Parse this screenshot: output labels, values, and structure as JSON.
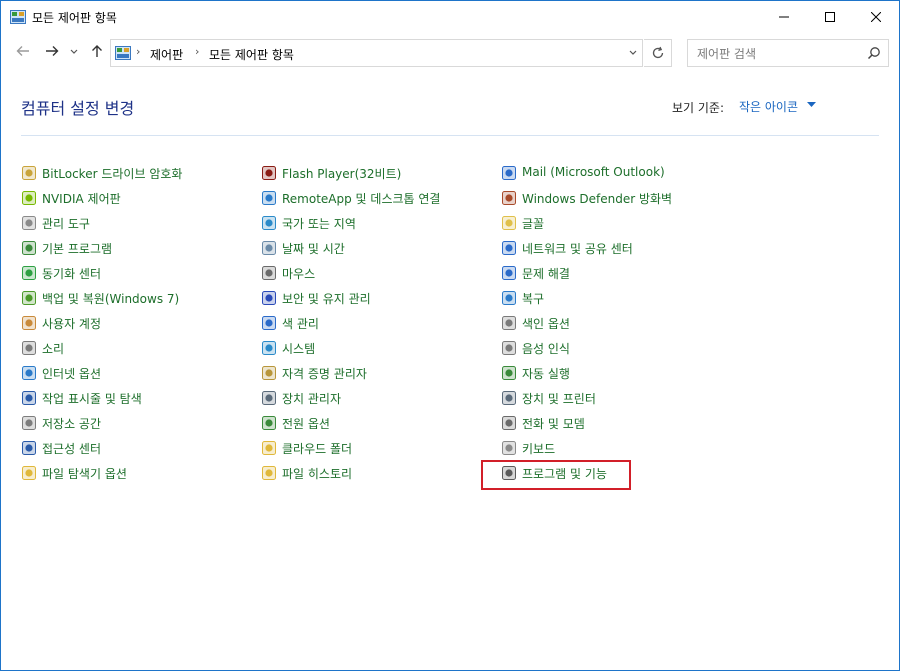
{
  "window": {
    "title": "모든 제어판 항목",
    "minimize": "—",
    "maximize": "☐",
    "close": "✕"
  },
  "nav": {
    "back": "←",
    "forward": "→",
    "recent": "⌄",
    "up": "↑",
    "breadcrumbs": [
      "제어판",
      "모든 제어판 항목"
    ],
    "separator": "›",
    "dropdown": "⌄",
    "refresh": "↻"
  },
  "search": {
    "placeholder": "제어판 검색"
  },
  "header": {
    "title": "컴퓨터 설정 변경",
    "view_by_label": "보기 기준:",
    "view_by_value": "작은 아이콘"
  },
  "columns": [
    [
      {
        "label": "BitLocker 드라이브 암호화",
        "icon": "bitlocker-icon",
        "color": "#c9a43a"
      },
      {
        "label": "NVIDIA 제어판",
        "icon": "nvidia-icon",
        "color": "#76b900"
      },
      {
        "label": "관리 도구",
        "icon": "admin-tools-icon",
        "color": "#8a8a8a"
      },
      {
        "label": "기본 프로그램",
        "icon": "default-programs-icon",
        "color": "#3a8a3a"
      },
      {
        "label": "동기화 센터",
        "icon": "sync-center-icon",
        "color": "#2ea043"
      },
      {
        "label": "백업 및 복원(Windows 7)",
        "icon": "backup-restore-icon",
        "color": "#4c9a2a"
      },
      {
        "label": "사용자 계정",
        "icon": "user-accounts-icon",
        "color": "#c98a3a"
      },
      {
        "label": "소리",
        "icon": "sound-icon",
        "color": "#7a7a7a"
      },
      {
        "label": "인터넷 옵션",
        "icon": "internet-options-icon",
        "color": "#2a7ac9"
      },
      {
        "label": "작업 표시줄 및 탐색",
        "icon": "taskbar-icon",
        "color": "#2a5aa8"
      },
      {
        "label": "저장소 공간",
        "icon": "storage-spaces-icon",
        "color": "#7d7d7d"
      },
      {
        "label": "접근성 센터",
        "icon": "ease-of-access-icon",
        "color": "#2a5aa8"
      },
      {
        "label": "파일 탐색기 옵션",
        "icon": "file-explorer-options-icon",
        "color": "#e0b83a"
      }
    ],
    [
      {
        "label": "Flash Player(32비트)",
        "icon": "flash-player-icon",
        "color": "#8a1c14"
      },
      {
        "label": "RemoteApp 및 데스크톱 연결",
        "icon": "remoteapp-icon",
        "color": "#2a7ac9"
      },
      {
        "label": "국가 또는 지역",
        "icon": "region-icon",
        "color": "#2a8ac9"
      },
      {
        "label": "날짜 및 시간",
        "icon": "date-time-icon",
        "color": "#6a8aa8"
      },
      {
        "label": "마우스",
        "icon": "mouse-icon",
        "color": "#6a6a6a"
      },
      {
        "label": "보안 및 유지 관리",
        "icon": "security-maintenance-icon",
        "color": "#2a4ab8"
      },
      {
        "label": "색 관리",
        "icon": "color-management-icon",
        "color": "#2a6ac9"
      },
      {
        "label": "시스템",
        "icon": "system-icon",
        "color": "#2a8ac9"
      },
      {
        "label": "자격 증명 관리자",
        "icon": "credential-manager-icon",
        "color": "#b8963a"
      },
      {
        "label": "장치 관리자",
        "icon": "device-manager-icon",
        "color": "#5a6a7a"
      },
      {
        "label": "전원 옵션",
        "icon": "power-options-icon",
        "color": "#3a8a3a"
      },
      {
        "label": "클라우드 폴더",
        "icon": "work-folders-icon",
        "color": "#e0b83a"
      },
      {
        "label": "파일 히스토리",
        "icon": "file-history-icon",
        "color": "#e0b83a"
      }
    ],
    [
      {
        "label": "Mail (Microsoft Outlook)",
        "icon": "mail-icon",
        "color": "#2a6ac9"
      },
      {
        "label": "Windows Defender 방화벽",
        "icon": "firewall-icon",
        "color": "#a84a2a"
      },
      {
        "label": "글꼴",
        "icon": "fonts-icon",
        "color": "#e0c04a"
      },
      {
        "label": "네트워크 및 공유 센터",
        "icon": "network-sharing-icon",
        "color": "#2a6ac9"
      },
      {
        "label": "문제 해결",
        "icon": "troubleshooting-icon",
        "color": "#2a6ac9"
      },
      {
        "label": "복구",
        "icon": "recovery-icon",
        "color": "#2a7ac9"
      },
      {
        "label": "색인 옵션",
        "icon": "indexing-options-icon",
        "color": "#7a7a7a"
      },
      {
        "label": "음성 인식",
        "icon": "speech-recognition-icon",
        "color": "#7a7a7a"
      },
      {
        "label": "자동 실행",
        "icon": "autoplay-icon",
        "color": "#3a8a3a"
      },
      {
        "label": "장치 및 프린터",
        "icon": "devices-printers-icon",
        "color": "#5a6a7a"
      },
      {
        "label": "전화 및 모뎀",
        "icon": "phone-modem-icon",
        "color": "#6a6a6a"
      },
      {
        "label": "키보드",
        "icon": "keyboard-icon",
        "color": "#8a8a8a"
      },
      {
        "label": "프로그램 및 기능",
        "icon": "programs-features-icon",
        "color": "#5a5a5a"
      }
    ]
  ],
  "highlighted_item": "프로그램 및 기능",
  "colors": {
    "link": "#1c6e2a",
    "heading": "#1e3287",
    "accent": "#1a66c0",
    "highlight": "#d21f29",
    "frame": "#1e74c9"
  }
}
